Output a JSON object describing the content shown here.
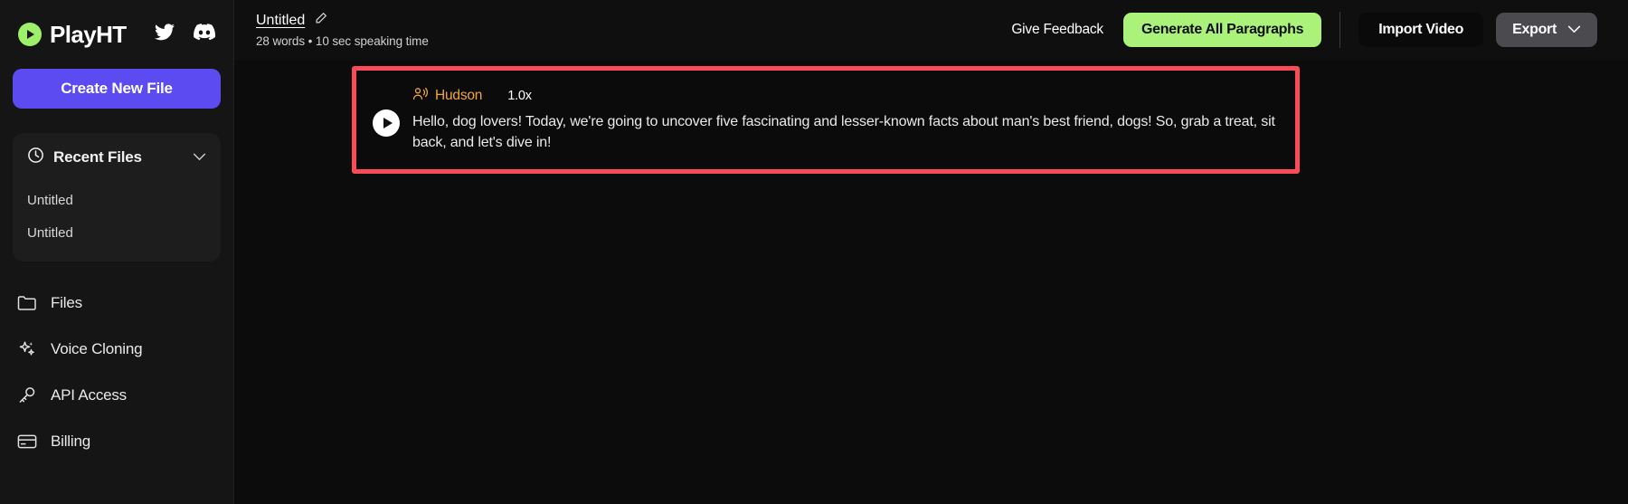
{
  "brand": {
    "name": "PlayHT",
    "logo_icon": "play-circle-icon",
    "socials": [
      {
        "icon": "twitter-icon",
        "name": "twitter-link"
      },
      {
        "icon": "discord-icon",
        "name": "discord-link"
      }
    ]
  },
  "sidebar": {
    "create_button": "Create New File",
    "recent": {
      "icon": "clock-icon",
      "title": "Recent Files",
      "chevron": "chevron-down-icon",
      "items": [
        {
          "label": "Untitled"
        },
        {
          "label": "Untitled"
        }
      ]
    },
    "nav": [
      {
        "label": "Files",
        "icon": "folder-icon"
      },
      {
        "label": "Voice Cloning",
        "icon": "sparkles-icon"
      },
      {
        "label": "API Access",
        "icon": "key-icon"
      },
      {
        "label": "Billing",
        "icon": "credit-card-icon"
      }
    ]
  },
  "topbar": {
    "doc_title": "Untitled",
    "edit_icon": "pencil-edit-icon",
    "doc_meta": "28 words • 10 sec speaking time",
    "feedback_label": "Give Feedback",
    "generate_label": "Generate All Paragraphs",
    "import_label": "Import Video",
    "export_label": "Export",
    "export_chevron": "chevron-down-icon"
  },
  "editor": {
    "highlight_color": "#fa4c58",
    "paragraph": {
      "play_icon": "play-button-icon",
      "voice_icon": "speaker-person-icon",
      "voice_name": "Hudson",
      "voice_color": "#f0a639",
      "speed": "1.0x",
      "text": "Hello, dog lovers! Today, we're going to uncover five fascinating and lesser-known facts about man's best friend, dogs! So, grab a treat, sit back, and let's dive in!"
    }
  },
  "colors": {
    "accent_green": "#aaf279",
    "accent_purple": "#5b4bf0",
    "background": "#0c0c0c",
    "sidebar": "#151515"
  }
}
